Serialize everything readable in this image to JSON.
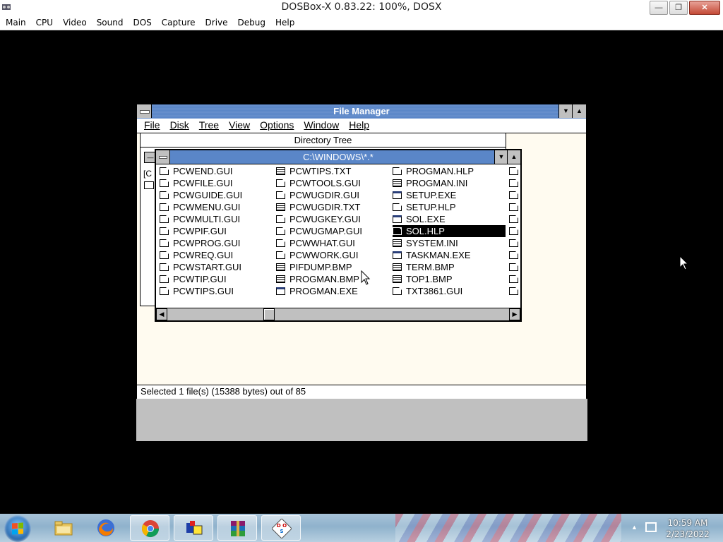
{
  "host": {
    "title": "DOSBox-X 0.83.22: 100%, DOSX",
    "menu": [
      "Main",
      "CPU",
      "Video",
      "Sound",
      "DOS",
      "Capture",
      "Drive",
      "Debug",
      "Help"
    ],
    "controls": {
      "minimize": "—",
      "maximize": "❐",
      "close": "✕"
    }
  },
  "file_manager": {
    "title": "File Manager",
    "menu": [
      {
        "label": "File"
      },
      {
        "label": "Disk"
      },
      {
        "label": "Tree"
      },
      {
        "label": "View"
      },
      {
        "label": "Options"
      },
      {
        "label": "Window"
      },
      {
        "label": "Help"
      }
    ],
    "status": "Selected 1 file(s) (15388 bytes) out of 85"
  },
  "directory_tree": {
    "title": "Directory Tree",
    "drive_label": "[C"
  },
  "directory_window": {
    "title": "C:\\WINDOWS\\*.*",
    "columns": [
      [
        {
          "name": "PCWEND.GUI",
          "icon": "doc"
        },
        {
          "name": "PCWFILE.GUI",
          "icon": "doc"
        },
        {
          "name": "PCWGUIDE.GUI",
          "icon": "doc"
        },
        {
          "name": "PCWMENU.GUI",
          "icon": "doc"
        },
        {
          "name": "PCWMULTI.GUI",
          "icon": "doc"
        },
        {
          "name": "PCWPIF.GUI",
          "icon": "doc"
        },
        {
          "name": "PCWPROG.GUI",
          "icon": "doc"
        },
        {
          "name": "PCWREQ.GUI",
          "icon": "doc"
        },
        {
          "name": "PCWSTART.GUI",
          "icon": "doc"
        },
        {
          "name": "PCWTIP.GUI",
          "icon": "doc"
        },
        {
          "name": "PCWTIPS.GUI",
          "icon": "doc"
        }
      ],
      [
        {
          "name": "PCWTIPS.TXT",
          "icon": "txt"
        },
        {
          "name": "PCWTOOLS.GUI",
          "icon": "doc"
        },
        {
          "name": "PCWUGDIR.GUI",
          "icon": "doc"
        },
        {
          "name": "PCWUGDIR.TXT",
          "icon": "txt"
        },
        {
          "name": "PCWUGKEY.GUI",
          "icon": "doc"
        },
        {
          "name": "PCWUGMAP.GUI",
          "icon": "doc"
        },
        {
          "name": "PCWWHAT.GUI",
          "icon": "doc"
        },
        {
          "name": "PCWWORK.GUI",
          "icon": "doc"
        },
        {
          "name": "PIFDUMP.BMP",
          "icon": "txt"
        },
        {
          "name": "PROGMAN.BMP",
          "icon": "txt"
        },
        {
          "name": "PROGMAN.EXE",
          "icon": "app"
        }
      ],
      [
        {
          "name": "PROGMAN.HLP",
          "icon": "doc"
        },
        {
          "name": "PROGMAN.INI",
          "icon": "txt"
        },
        {
          "name": "SETUP.EXE",
          "icon": "app"
        },
        {
          "name": "SETUP.HLP",
          "icon": "doc"
        },
        {
          "name": "SOL.EXE",
          "icon": "app"
        },
        {
          "name": "SOL.HLP",
          "icon": "doc",
          "selected": true
        },
        {
          "name": "SYSTEM.INI",
          "icon": "txt"
        },
        {
          "name": "TASKMAN.EXE",
          "icon": "app"
        },
        {
          "name": "TERM.BMP",
          "icon": "txt"
        },
        {
          "name": "TOP1.BMP",
          "icon": "txt"
        },
        {
          "name": "TXT3861.GUI",
          "icon": "doc"
        }
      ]
    ]
  },
  "taskbar": {
    "apps": [
      "windows-explorer-icon",
      "firefox-icon",
      "chrome-icon",
      "window-layout-icon",
      "winrar-icon",
      "dosbox-icon"
    ],
    "clock_time": "10:59 AM",
    "clock_date": "2/23/2022"
  }
}
